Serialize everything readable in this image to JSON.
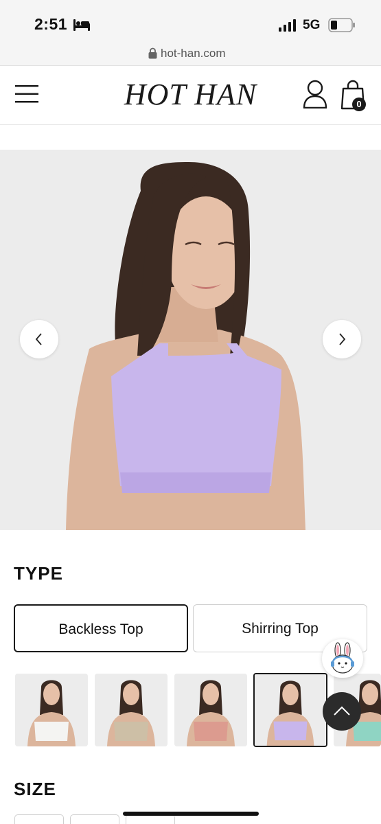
{
  "status_bar": {
    "time": "2:51",
    "network": "5G",
    "icons": [
      "bed-icon",
      "signal-icon",
      "battery-icon"
    ]
  },
  "browser": {
    "url": "hot-han.com",
    "lock_icon": "lock-icon"
  },
  "header": {
    "brand": "HOT HAN",
    "cart_count": "0",
    "icons": [
      "menu-icon",
      "account-icon",
      "cart-icon"
    ]
  },
  "gallery": {
    "image": "model wearing lavender halter bra top",
    "controls": [
      "chevron-left-icon",
      "chevron-right-icon"
    ]
  },
  "type_section": {
    "title": "TYPE",
    "options": [
      "Backless Top",
      "Shirring Top"
    ],
    "selected": "Backless Top"
  },
  "colors": {
    "swatches": [
      {
        "name": "white",
        "hex": "#f4f4f2"
      },
      {
        "name": "beige",
        "hex": "#cdbfa6"
      },
      {
        "name": "pink",
        "hex": "#dc9b8f"
      },
      {
        "name": "lavender",
        "hex": "#c8b6ec"
      },
      {
        "name": "mint",
        "hex": "#8fd4c3"
      }
    ],
    "selected": "lavender"
  },
  "size_section": {
    "title": "SIZE"
  },
  "floating": {
    "chat": "chat-bunny-icon",
    "scroll_top": "chevron-up-icon"
  },
  "colors_ui": {
    "accent": "#1a1a1a",
    "background": "#ffffff",
    "image_background": "#ececec"
  }
}
